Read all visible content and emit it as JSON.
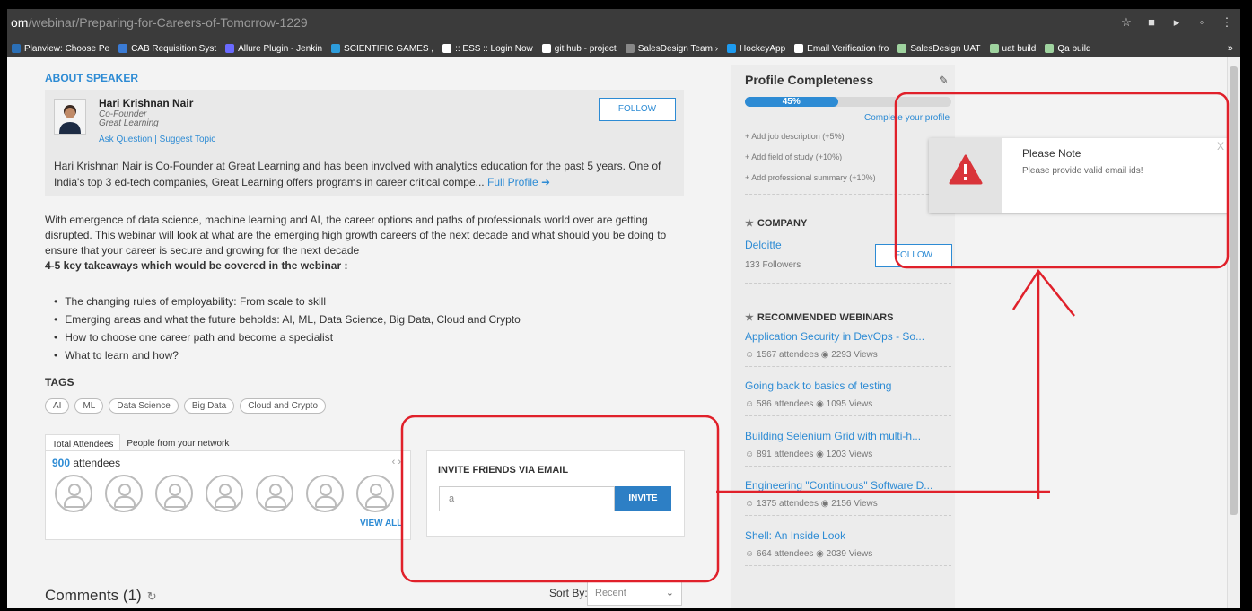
{
  "browser": {
    "url_prefix": "om",
    "url_path": "/webinar/Preparing-for-Careers-of-Tomorrow-1229",
    "bookmarks": [
      {
        "label": "Planview: Choose Pe",
        "color": "#2b6fb6"
      },
      {
        "label": "CAB Requisition Syst",
        "color": "#3a7bd5"
      },
      {
        "label": "Allure Plugin - Jenkin",
        "color": "#6a6aff"
      },
      {
        "label": "SCIENTIFIC GAMES ,",
        "color": "#2d9cdb"
      },
      {
        "label": ":: ESS :: Login Now",
        "color": "#ffffff"
      },
      {
        "label": "git hub - project",
        "color": "#ffffff"
      },
      {
        "label": "SalesDesign Team ›",
        "color": "#888888"
      },
      {
        "label": "HockeyApp",
        "color": "#1d9bf0"
      },
      {
        "label": "Email Verification fro",
        "color": "#ffffff"
      },
      {
        "label": "SalesDesign UAT",
        "color": "#9fd39f"
      },
      {
        "label": "uat build",
        "color": "#9fd39f"
      },
      {
        "label": "Qa build",
        "color": "#9fd39f"
      }
    ],
    "more": "»"
  },
  "about": {
    "title": "ABOUT SPEAKER",
    "name": "Hari Krishnan Nair",
    "role": "Co-Founder",
    "org": "Great Learning",
    "ask": "Ask Question",
    "sep": "|",
    "suggest": "Suggest Topic",
    "follow": "FOLLOW",
    "bio": "Hari Krishnan Nair is Co-Founder at Great Learning and has been involved with analytics education for the past 5 years. One of India's top 3 ed-tech companies, Great Learning offers programs in career critical compe...",
    "full_profile": "Full Profile"
  },
  "description": {
    "text": "With emergence of data science, machine learning and AI, the career options and paths of professionals world over are getting disrupted. This webinar will look at what are the emerging high growth careers of the next decade and what should you be doing to ensure that your career is secure and growing for the next decade",
    "takeaway": "4-5 key takeaways which would be covered in the webinar :",
    "bullets": [
      "The changing rules of employability: From scale to skill",
      "Emerging areas and what the future beholds: AI, ML, Data Science, Big Data, Cloud and Crypto",
      "How to choose one career path and become a specialist",
      "What to learn and how?"
    ]
  },
  "tags": {
    "title": "TAGS",
    "items": [
      "AI",
      "ML",
      "Data Science",
      "Big Data",
      "Cloud and Crypto"
    ]
  },
  "attendees": {
    "tab_total": "Total Attendees",
    "tab_network": "People from your network",
    "count": "900",
    "count_label": "attendees",
    "arrows": "‹ ›",
    "view_all": "VIEW ALL"
  },
  "invite": {
    "title": "INVITE FRIENDS VIA EMAIL",
    "value": "a",
    "button": "INVITE"
  },
  "comments": {
    "title": "Comments (1)",
    "sort_label": "Sort By:",
    "sort_value": "Recent"
  },
  "profile": {
    "title": "Profile Completeness",
    "percent": 45,
    "percent_label": "45%",
    "complete_link": "Complete your profile",
    "adds": [
      "+ Add job description (+5%)",
      "+ Add field of study (+10%)",
      "+ Add professional summary (+10%)"
    ]
  },
  "company": {
    "title": "COMPANY",
    "name": "Deloitte",
    "followers": "133 Followers",
    "follow": "FOLLOW"
  },
  "recommended": {
    "title": "RECOMMENDED WEBINARS",
    "items": [
      {
        "title": "Application Security in DevOps - So...",
        "meta": "1567 attendees  ◉ 2293 Views"
      },
      {
        "title": "Going back to basics of testing",
        "meta": "586 attendees  ◉ 1095 Views"
      },
      {
        "title": "Building Selenium Grid with multi-h...",
        "meta": "891 attendees  ◉ 1203 Views"
      },
      {
        "title": "Engineering \"Continuous\" Software D...",
        "meta": "1375 attendees  ◉ 2156 Views"
      },
      {
        "title": "Shell: An Inside Look",
        "meta": "664 attendees  ◉ 2039 Views"
      }
    ]
  },
  "note": {
    "title": "Please Note",
    "message": "Please provide valid email ids!",
    "close": "X"
  },
  "annotation_color": "#e0202a"
}
